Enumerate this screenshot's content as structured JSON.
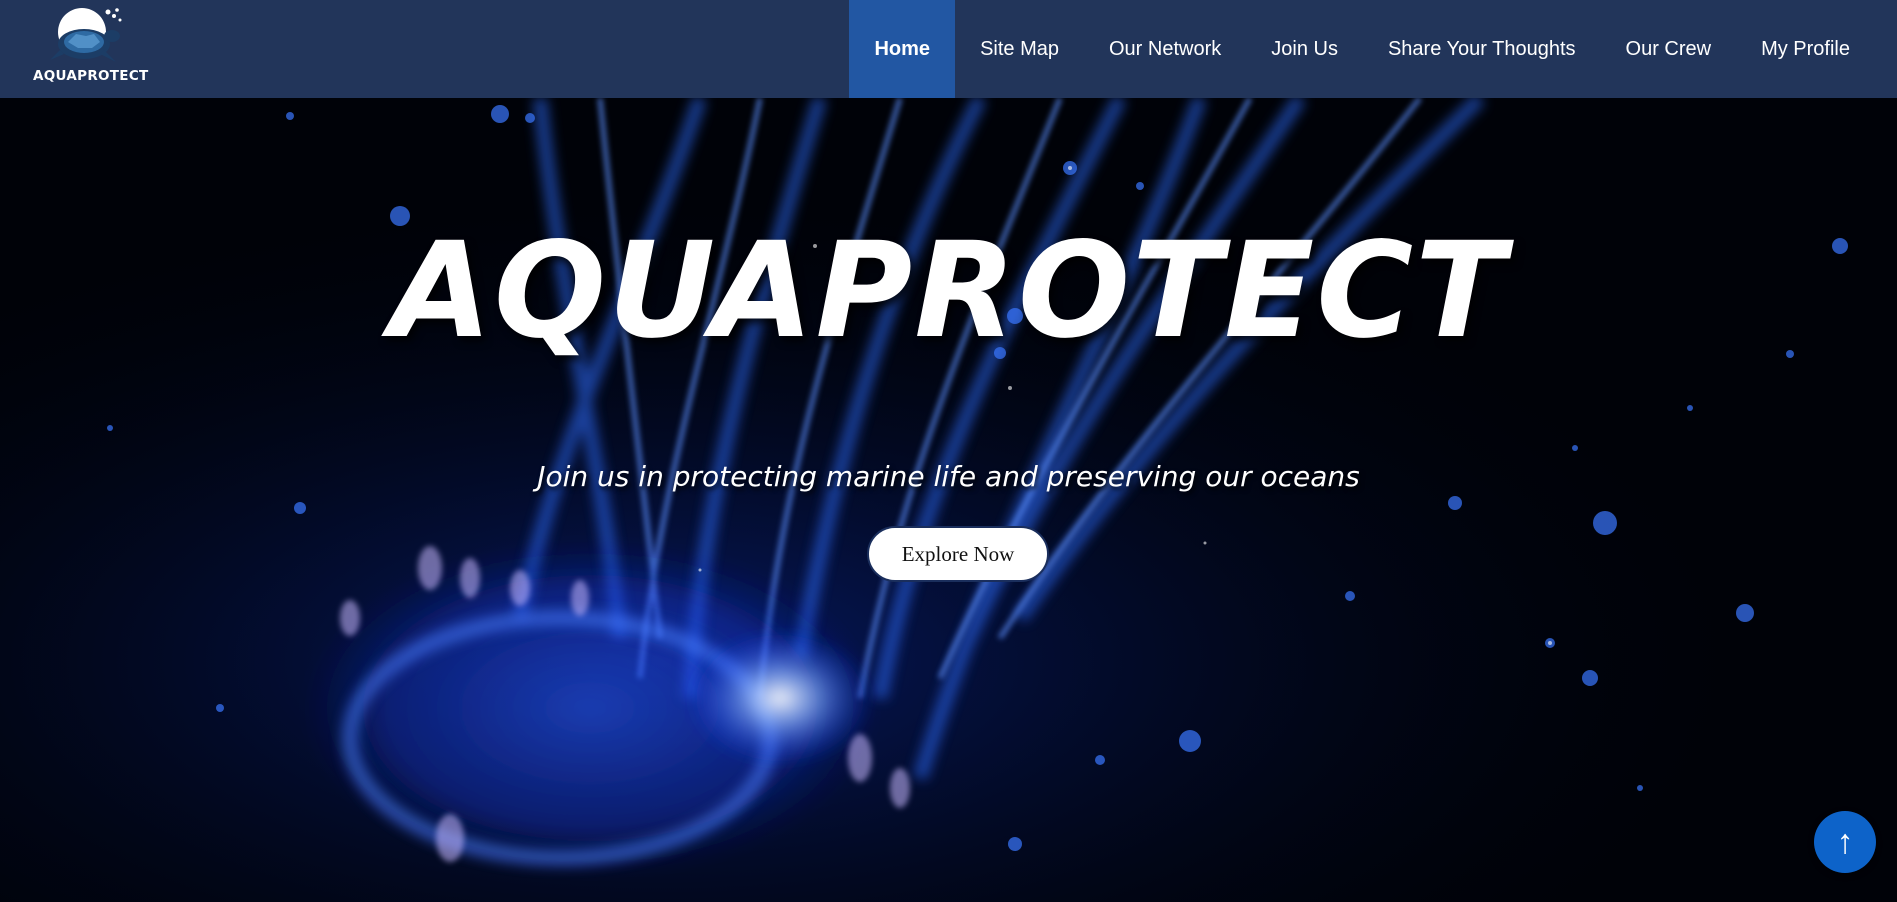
{
  "brand": {
    "name": "AQUAPROTECT",
    "logo_icon": "turtle-icon"
  },
  "nav": {
    "items": [
      {
        "label": "Home",
        "active": true
      },
      {
        "label": "Site Map",
        "active": false
      },
      {
        "label": "Our Network",
        "active": false
      },
      {
        "label": "Join Us",
        "active": false
      },
      {
        "label": "Share Your Thoughts",
        "active": false
      },
      {
        "label": "Our Crew",
        "active": false
      },
      {
        "label": "My Profile",
        "active": false
      }
    ]
  },
  "hero": {
    "title": "AQUAPROTECT",
    "subtitle": "Join us in protecting marine life and preserving our oceans",
    "cta_label": "Explore Now",
    "background": "jellyfish-image"
  },
  "scroll_top": {
    "icon": "arrow-up-icon",
    "glyph": "↑"
  },
  "colors": {
    "navbar": "#22355a",
    "nav_active": "#2257a3",
    "accent": "#0d63c9"
  }
}
